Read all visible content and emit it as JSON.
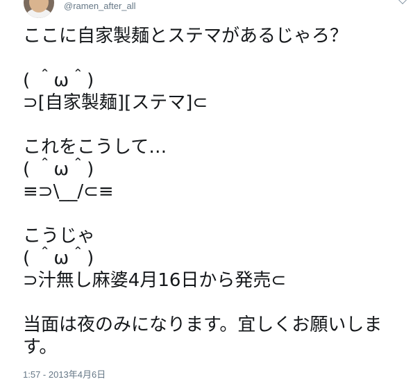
{
  "tweet": {
    "avatar_icon": "user-avatar",
    "handle": "@ramen_after_all",
    "menu_icon": "chevron-down-icon",
    "lines": [
      "ここに自家製麺とステマがあるじゃろ？",
      "",
      "( ＾ω＾)",
      "⊃[自家製麺][ステマ]⊂",
      "",
      "これをこうして…",
      "( ＾ω＾)",
      "≡⊃\\__/⊂≡",
      "",
      "こうじゃ",
      "( ＾ω＾)",
      "⊃汁無し麻婆4月16日から発売⊂",
      "",
      "当面は夜のみになります。宜しくお願いします。"
    ],
    "timestamp": "1:57 - 2013年4月6日"
  }
}
